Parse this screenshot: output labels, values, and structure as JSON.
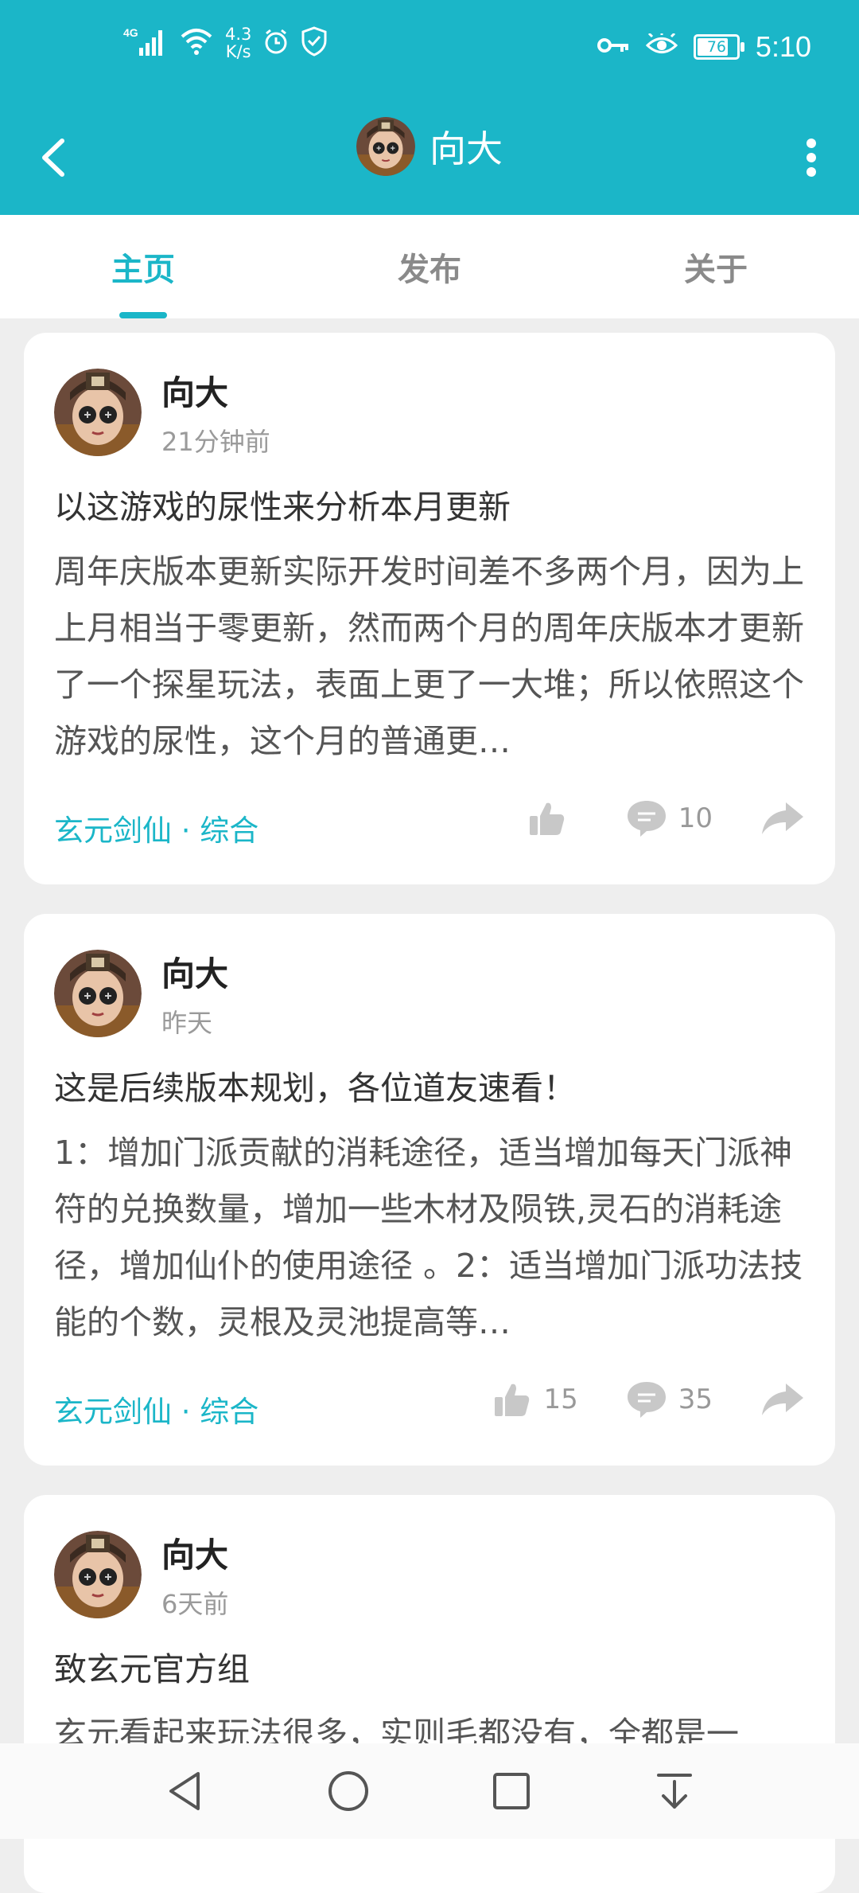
{
  "status_bar": {
    "network": "4G",
    "speed_value": "4.3",
    "speed_unit": "K/s",
    "battery": "76",
    "time": "5:10"
  },
  "app_bar": {
    "title": "向大"
  },
  "tabs": [
    {
      "label": "主页",
      "active": true
    },
    {
      "label": "发布",
      "active": false
    },
    {
      "label": "关于",
      "active": false
    }
  ],
  "posts": [
    {
      "author": "向大",
      "time": "21分钟前",
      "title": "以这游戏的尿性来分析本月更新",
      "body": "周年庆版本更新实际开发时间差不多两个月，因为上上月相当于零更新，然而两个月的周年庆版本才更新了一个探星玩法，表面上更了一大堆；所以依照这个游戏的尿性，这个月的普通更…",
      "tag": "玄元剑仙 · 综合",
      "likes": "",
      "comments": "10"
    },
    {
      "author": "向大",
      "time": "昨天",
      "title": "这是后续版本规划，各位道友速看！",
      "body": "1：增加门派贡献的消耗途径，适当增加每天门派神符的兑换数量，增加一些木材及陨铁,灵石的消耗途径，增加仙仆的使用途径 。2：适当增加门派功法技能的个数，灵根及灵池提高等…",
      "tag": "玄元剑仙 · 综合",
      "likes": "15",
      "comments": "35"
    },
    {
      "author": "向大",
      "time": "6天前",
      "title": "致玄元官方组",
      "body": "玄元看起来玩法很多，实则毛都没有，全都是一",
      "tag": "",
      "likes": "",
      "comments": ""
    }
  ],
  "colors": {
    "accent": "#1bb6c8",
    "background": "#eeeeee"
  },
  "icons": {
    "back": "back-arrow-icon",
    "more": "more-vertical-icon",
    "like": "thumbs-up-icon",
    "comment": "comment-icon",
    "share": "share-icon"
  }
}
